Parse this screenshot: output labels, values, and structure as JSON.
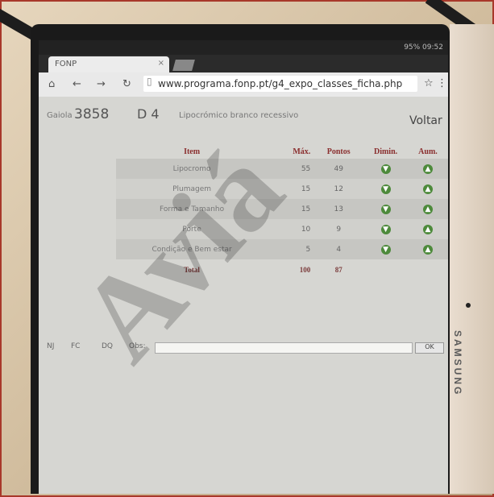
{
  "watermark": "Aviá",
  "device": {
    "brand": "SAMSUNG"
  },
  "statusbar": {
    "right": "95% 09:52"
  },
  "browser": {
    "tab_title": "FONP",
    "tab_close": "×",
    "url": "www.programa.fonp.pt/g4_expo_classes_ficha.php",
    "back_icon": "back-arrow-icon",
    "home_icon": "home-icon",
    "reload_icon": "reload-icon",
    "star_icon": "star-icon",
    "menu_icon": "menu-icon"
  },
  "page": {
    "gaiola_label": "Gaiola",
    "gaiola_value": "3858",
    "class_code": "D 4",
    "description": "Lipocrómico branco recessivo",
    "voltar": "Voltar"
  },
  "table": {
    "headers": [
      "Item",
      "Máx.",
      "Pontos",
      "Dimin.",
      "Aum."
    ],
    "rows": [
      {
        "item": "Lipocromo",
        "max": "55",
        "pontos": "49"
      },
      {
        "item": "Plumagem",
        "max": "15",
        "pontos": "12"
      },
      {
        "item": "Forma e Tamanho",
        "max": "15",
        "pontos": "13"
      },
      {
        "item": "Porte",
        "max": "10",
        "pontos": "9"
      },
      {
        "item": "Condição e Bem estar",
        "max": "5",
        "pontos": "4"
      }
    ],
    "total_label": "Total",
    "total_max": "100",
    "total_pontos": "87"
  },
  "footer": {
    "nj": "NJ",
    "fc": "FC",
    "dq": "DQ",
    "obs_label": "Obs:",
    "obs_value": "",
    "ok": "OK"
  },
  "colors": {
    "accent_red": "#8a2e2e",
    "button_green": "#4d8a3b"
  }
}
